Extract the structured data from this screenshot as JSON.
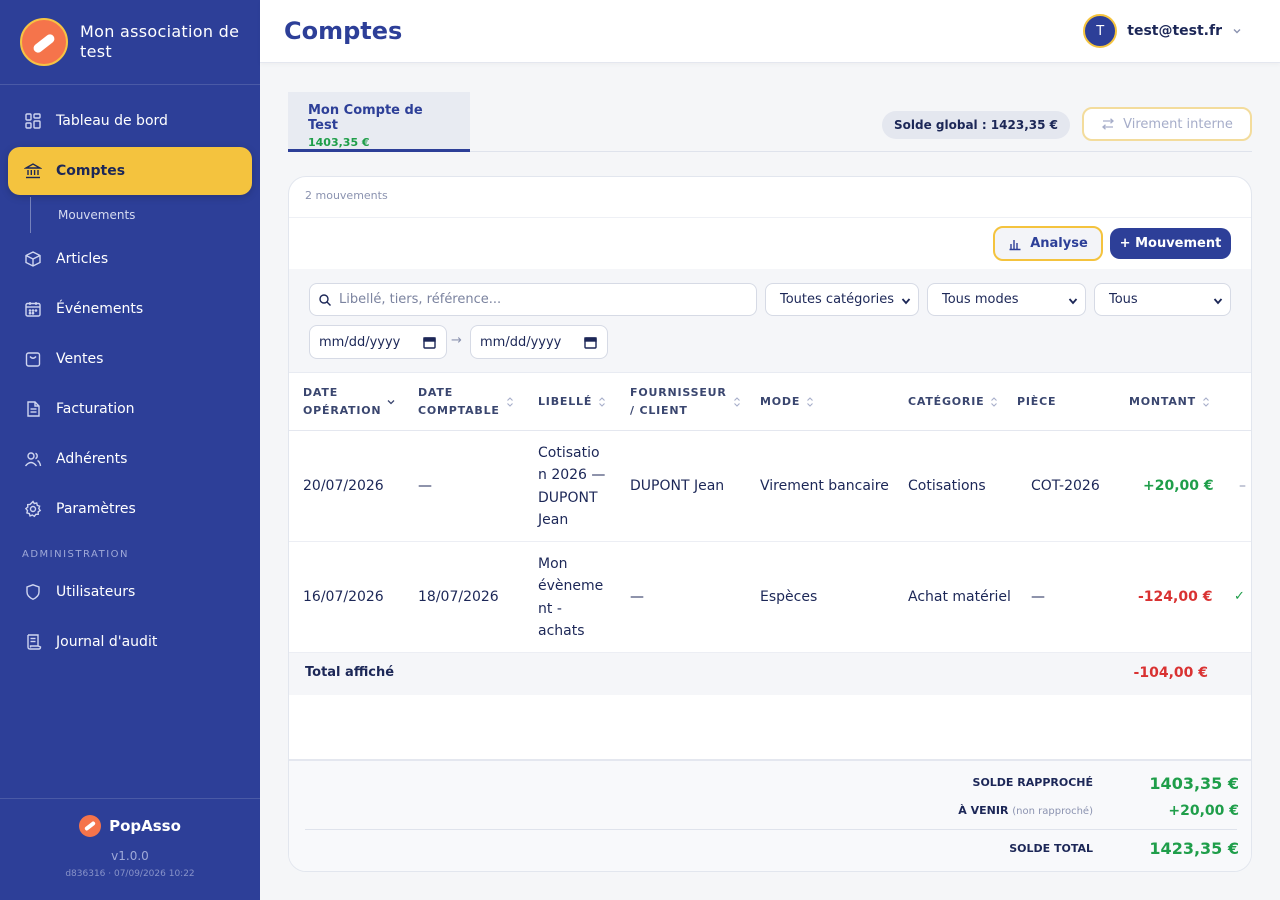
{
  "sidebar": {
    "org_name": "Mon association de test",
    "items": [
      {
        "label": "Tableau de bord",
        "icon": "dashboard-icon"
      },
      {
        "label": "Comptes",
        "icon": "bank-icon",
        "active": true
      },
      {
        "label": "Articles",
        "icon": "box-icon"
      },
      {
        "label": "Événements",
        "icon": "calendar-icon"
      },
      {
        "label": "Ventes",
        "icon": "bag-icon"
      },
      {
        "label": "Facturation",
        "icon": "document-icon"
      },
      {
        "label": "Adhérents",
        "icon": "users-icon"
      },
      {
        "label": "Paramètres",
        "icon": "gear-icon"
      }
    ],
    "subitem": "Mouvements",
    "admin_section": "ADMINISTRATION",
    "admin_items": [
      {
        "label": "Utilisateurs",
        "icon": "shield-icon"
      },
      {
        "label": "Journal d'audit",
        "icon": "scroll-icon"
      }
    ],
    "footer": {
      "brand": "PopAsso",
      "version": "v1.0.0",
      "build": "d836316 · 07/09/2026 10:22"
    }
  },
  "header": {
    "title": "Comptes",
    "user_initial": "T",
    "user_email": "test@test.fr"
  },
  "account_tab": {
    "name": "Mon Compte de Test",
    "balance": "1403,35 €"
  },
  "solde_global": "Solde global : 1423,35 €",
  "virement_label": "Virement interne",
  "card": {
    "count": "2 mouvements",
    "analyse_label": "Analyse",
    "mouvement_label": "+ Mouvement"
  },
  "filters": {
    "search_placeholder": "Libellé, tiers, référence...",
    "category": "Toutes catégories",
    "mode": "Tous modes",
    "status": "Tous",
    "date_from": "mm/dd/yyyy",
    "date_to": "mm/dd/yyyy",
    "arrow": "→"
  },
  "table": {
    "headers": {
      "date_op_1": "DATE",
      "date_op_2": "OPÉRATION",
      "date_cpt_1": "DATE",
      "date_cpt_2": "COMPTABLE",
      "libelle": "LIBELLÉ",
      "tiers_1": "FOURNISSEUR",
      "tiers_2": "/ CLIENT",
      "mode": "MODE",
      "categorie": "CATÉGORIE",
      "piece": "PIÈCE",
      "montant": "MONTANT"
    },
    "rows": [
      {
        "date_op": "20/07/2026",
        "date_cpt": "—",
        "libelle_lines": [
          "Cotisatio",
          "n 2026 —",
          "DUPONT",
          "Jean"
        ],
        "tiers": "DUPONT Jean",
        "mode": "Virement bancaire",
        "categorie": "Cotisations",
        "piece": "COT-2026",
        "montant": "+20,00 €",
        "status": "–"
      },
      {
        "date_op": "16/07/2026",
        "date_cpt": "18/07/2026",
        "libelle_lines": [
          "Mon",
          "évèneme",
          "nt -",
          "achats"
        ],
        "tiers": "—",
        "mode": "Espèces",
        "categorie": "Achat matériel",
        "piece": "—",
        "montant": "-124,00 €",
        "status": "✓"
      }
    ],
    "total_label": "Total affiché",
    "total_amount": "-104,00 €"
  },
  "summary": {
    "rapproche_label": "SOLDE RAPPROCHÉ",
    "rapproche_value": "1403,35 €",
    "venir_label": "À VENIR",
    "venir_note": "(non rapproché)",
    "venir_value": "+20,00 €",
    "total_label": "SOLDE TOTAL",
    "total_value": "1423,35 €"
  },
  "colors": {
    "sidebar": "#2d3f98",
    "accent": "#f4c33e",
    "positive": "#1f9e4a",
    "negative": "#d93232"
  }
}
